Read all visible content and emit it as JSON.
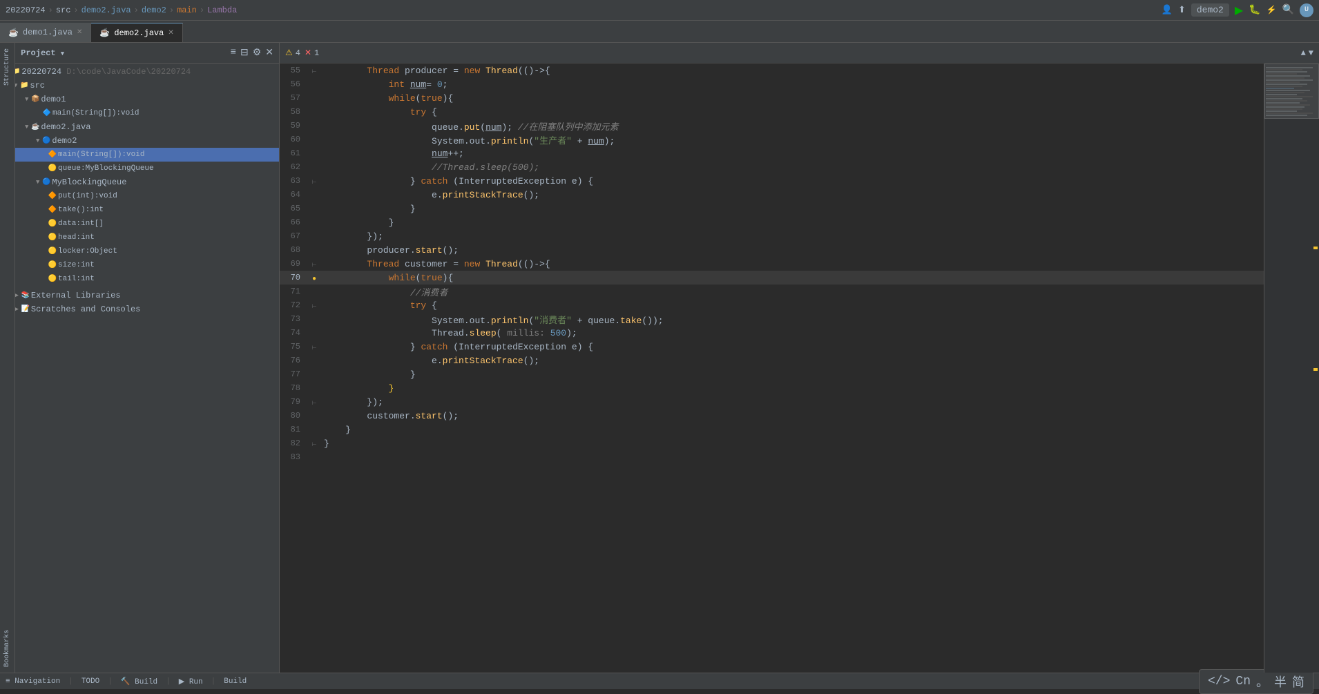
{
  "topbar": {
    "date": "20220724",
    "items": [
      "src",
      "demo2.java",
      "demo2",
      "main",
      "Lambda"
    ],
    "project_name": "demo2",
    "breadcrumb_sep": ">"
  },
  "tabs": [
    {
      "label": "demo1.java",
      "active": false
    },
    {
      "label": "demo2.java",
      "active": true
    }
  ],
  "sidebar": {
    "header": "Project",
    "root": "20220724",
    "root_path": "D:\\code\\JavaCode\\20220724",
    "items": [
      {
        "id": "src",
        "label": "src",
        "depth": 1,
        "type": "folder",
        "open": true
      },
      {
        "id": "demo1",
        "label": "demo1",
        "depth": 2,
        "type": "package",
        "open": true
      },
      {
        "id": "main_string",
        "label": "main(String[]):void",
        "depth": 3,
        "type": "method"
      },
      {
        "id": "demo2_java",
        "label": "demo2.java",
        "depth": 2,
        "type": "file",
        "open": true
      },
      {
        "id": "demo2",
        "label": "demo2",
        "depth": 3,
        "type": "class",
        "open": true
      },
      {
        "id": "main_string2",
        "label": "main(String[]):void",
        "depth": 4,
        "type": "method",
        "selected": true
      },
      {
        "id": "queue_field",
        "label": "queue:MyBlockingQueue",
        "depth": 4,
        "type": "field"
      },
      {
        "id": "myblockingqueue",
        "label": "MyBlockingQueue",
        "depth": 3,
        "type": "class",
        "open": true
      },
      {
        "id": "put_int",
        "label": "put(int):void",
        "depth": 4,
        "type": "method"
      },
      {
        "id": "take_int",
        "label": "take():int",
        "depth": 4,
        "type": "method"
      },
      {
        "id": "data_int",
        "label": "data:int[]",
        "depth": 4,
        "type": "field"
      },
      {
        "id": "head_int",
        "label": "head:int",
        "depth": 4,
        "type": "field"
      },
      {
        "id": "locker_obj",
        "label": "locker:Object",
        "depth": 4,
        "type": "field"
      },
      {
        "id": "size_int",
        "label": "size:int",
        "depth": 4,
        "type": "field"
      },
      {
        "id": "tail_int",
        "label": "tail:int",
        "depth": 4,
        "type": "field"
      },
      {
        "id": "ext_libs",
        "label": "External Libraries",
        "depth": 1,
        "type": "folder"
      },
      {
        "id": "scratches",
        "label": "Scratches and Consoles",
        "depth": 1,
        "type": "folder"
      }
    ]
  },
  "editor": {
    "filename": "demo2.java",
    "warnings": "4",
    "errors": "1",
    "lines": [
      {
        "num": 55,
        "content": "        Thread producer = new Thread(()->{\n"
      },
      {
        "num": 56,
        "content": "            int num= 0;\n"
      },
      {
        "num": 57,
        "content": "            while(true){\n"
      },
      {
        "num": 58,
        "content": "                try {\n"
      },
      {
        "num": 59,
        "content": "                    queue.put(num); //在阻塞队列中添加元素\n"
      },
      {
        "num": 60,
        "content": "                    System.out.println(\"生产者\" + num);\n"
      },
      {
        "num": 61,
        "content": "                    num++;\n"
      },
      {
        "num": 62,
        "content": "                    //Thread.sleep(500);\n"
      },
      {
        "num": 63,
        "content": "                } catch (InterruptedException e) {\n"
      },
      {
        "num": 64,
        "content": "                    e.printStackTrace();\n"
      },
      {
        "num": 65,
        "content": "                }\n"
      },
      {
        "num": 66,
        "content": "            }\n"
      },
      {
        "num": 67,
        "content": "        });\n"
      },
      {
        "num": 68,
        "content": "        producer.start();\n"
      },
      {
        "num": 69,
        "content": "        Thread customer = new Thread(()->{\n"
      },
      {
        "num": 70,
        "content": "            while(true){\n"
      },
      {
        "num": 71,
        "content": "                //消费者\n"
      },
      {
        "num": 72,
        "content": "                try {\n"
      },
      {
        "num": 73,
        "content": "                    System.out.println(\"消费者\" + queue.take());\n"
      },
      {
        "num": 74,
        "content": "                    Thread.sleep( millis: 500);\n"
      },
      {
        "num": 75,
        "content": "                } catch (InterruptedException e) {\n"
      },
      {
        "num": 76,
        "content": "                    e.printStackTrace();\n"
      },
      {
        "num": 77,
        "content": "                }\n"
      },
      {
        "num": 78,
        "content": "            }\n"
      },
      {
        "num": 79,
        "content": "        });\n"
      },
      {
        "num": 80,
        "content": "        customer.start();\n"
      },
      {
        "num": 81,
        "content": "    }\n"
      },
      {
        "num": 82,
        "content": "}\n"
      },
      {
        "num": 83,
        "content": "\n"
      }
    ]
  },
  "statusbar": {
    "items": [
      "Navigation",
      "TODO",
      "Build",
      "Run",
      "Build"
    ],
    "cn_panel": "</> Cn 。半 简"
  },
  "left_labels": [
    "Structure",
    "Bookmarks"
  ]
}
